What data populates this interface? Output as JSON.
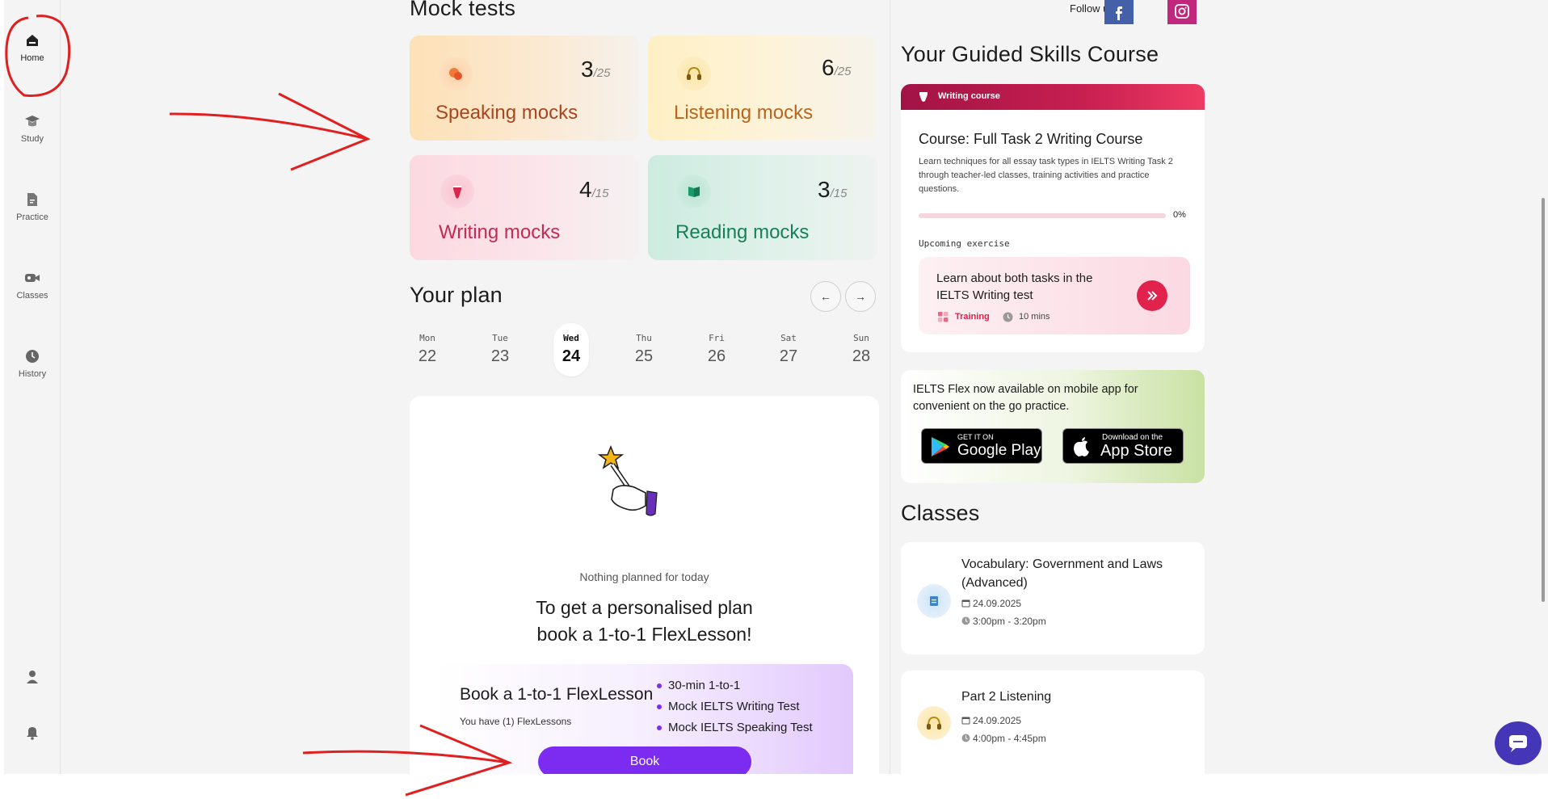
{
  "sidebar": {
    "items": [
      {
        "label": "Home",
        "icon": "home-icon"
      },
      {
        "label": "Study",
        "icon": "graduation-cap-icon"
      },
      {
        "label": "Practice",
        "icon": "document-icon"
      },
      {
        "label": "Classes",
        "icon": "video-camera-icon"
      },
      {
        "label": "History",
        "icon": "clock-icon"
      }
    ],
    "bottom_icons": [
      "user-icon",
      "bell-icon"
    ]
  },
  "mocks": {
    "heading": "Mock tests",
    "cards": [
      {
        "title": "Speaking mocks",
        "done": "3",
        "total": "/25",
        "color": "#a8461f"
      },
      {
        "title": "Listening mocks",
        "done": "6",
        "total": "/25",
        "color": "#b8651b"
      },
      {
        "title": "Writing mocks",
        "done": "4",
        "total": "/15",
        "color": "#c52a52"
      },
      {
        "title": "Reading mocks",
        "done": "3",
        "total": "/15",
        "color": "#17805a"
      }
    ]
  },
  "plan": {
    "heading": "Your plan",
    "days": [
      {
        "name": "Mon",
        "date": "22"
      },
      {
        "name": "Tue",
        "date": "23"
      },
      {
        "name": "Wed",
        "date": "24"
      },
      {
        "name": "Thu",
        "date": "25"
      },
      {
        "name": "Fri",
        "date": "26"
      },
      {
        "name": "Sat",
        "date": "27"
      },
      {
        "name": "Sun",
        "date": "28"
      }
    ],
    "selected_day": "Wed",
    "empty_text": "Nothing planned for today",
    "cta_line1": "To get a personalised plan",
    "cta_line2": "book a 1-to-1 FlexLesson!",
    "book": {
      "title": "Book a 1-to-1 FlexLesson",
      "subtitle": "You have (1) FlexLessons",
      "features": [
        "30-min 1-to-1",
        "Mock IELTS Writing Test",
        "Mock IELTS Speaking Test"
      ],
      "button": "Book"
    }
  },
  "header": {
    "follow_label": "Follow us:",
    "social": [
      "facebook-icon",
      "instagram-icon"
    ]
  },
  "course": {
    "heading": "Your Guided Skills Course",
    "tag": "Writing course",
    "title": "Course: Full Task 2 Writing Course",
    "description": "Learn techniques for all essay task types in IELTS Writing Task 2 through teacher-led classes, training activities and practice questions.",
    "progress_label": "0%",
    "progress": 0,
    "upcoming_label": "Upcoming exercise",
    "exercise": {
      "title": "Learn about both tasks in the IELTS Writing test",
      "type": "Training",
      "duration": "10 mins"
    }
  },
  "app_promo": {
    "text": "IELTS Flex now available on mobile app for convenient on the go practice.",
    "google_small": "GET IT ON",
    "google_big": "Google Play",
    "apple_small": "Download on the",
    "apple_big": "App Store"
  },
  "classes": {
    "heading": "Classes",
    "items": [
      {
        "title": "Vocabulary: Government and Laws (Advanced)",
        "date": "24.09.2025",
        "time": "3:00pm - 3:20pm"
      },
      {
        "title": "Part 2 Listening",
        "date": "24.09.2025",
        "time": "4:00pm - 4:45pm"
      }
    ]
  },
  "colors": {
    "accent": "#7b2cf0",
    "writing_red": "#e0224c",
    "chat_fab": "#4536b8"
  }
}
